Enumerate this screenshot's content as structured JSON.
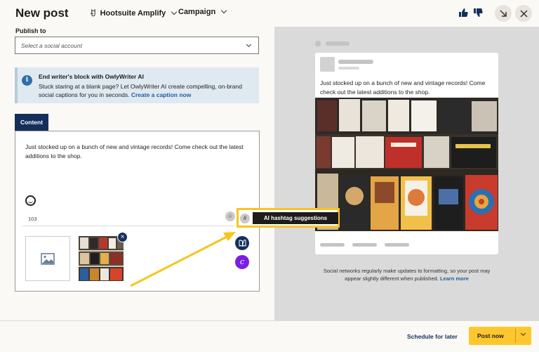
{
  "header": {
    "title": "New post",
    "org_name": "Hootsuite Amplify",
    "campaign_label": "Campaign"
  },
  "publish": {
    "label": "Publish to",
    "placeholder": "Select a social account"
  },
  "banner": {
    "title": "End writer's block with OwlyWriter AI",
    "body": "Stuck staring at a blank page? Let OwlyWriter AI create compelling, on-brand social captions for you in seconds.",
    "link": "Create a caption now"
  },
  "content": {
    "tab_label": "Content",
    "text": "Just stocked up on a bunch of new and vintage records! Come check out the latest additions to the shop.",
    "char_count": "103",
    "hash_symbol": "#"
  },
  "annotation": {
    "tooltip": "AI hashtag suggestions",
    "hash_symbol": "#"
  },
  "preview": {
    "post_text": "Just stocked up on a bunch of new and vintage records! Come check out the latest additions to the shop.",
    "disclaimer": "Social networks regularly make updates to formatting, so your post may appear slightly different when published.",
    "learn_more": "Learn more"
  },
  "footer": {
    "schedule_label": "Schedule for later",
    "post_now_label": "Post now"
  },
  "icons": {
    "remove": "close-icon",
    "side_button_1": "book-icon",
    "side_button_2": "canva-icon"
  },
  "colors": {
    "primary_navy": "#142f5c",
    "accent_yellow": "#ffc72e",
    "annotation_yellow": "#f7c51f",
    "banner_bg": "#dfe9f0",
    "link_blue": "#1f5fa0",
    "canva_purple": "#7a1ee5"
  }
}
